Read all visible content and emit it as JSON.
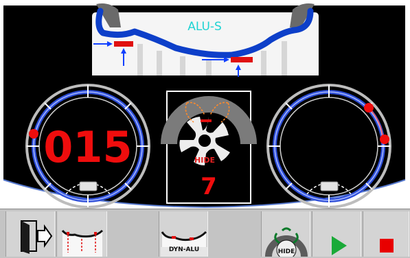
{
  "rim_profile": {
    "label": "ALU-S"
  },
  "left_gauge": {
    "value": "015"
  },
  "center_panel": {
    "hide_label": "HIDE",
    "spoke_count": "7"
  },
  "toolbar": {
    "dyn_alu_label": "DYN-ALU",
    "hide_label": "HIDE"
  },
  "colors": {
    "background": "#000000",
    "value_red": "#ef0d0d",
    "ring_blue": "#2f4fd8",
    "rim_blue": "#0d3fc9",
    "label_cyan": "#1fd3d3",
    "play_green": "#1aaa38"
  }
}
